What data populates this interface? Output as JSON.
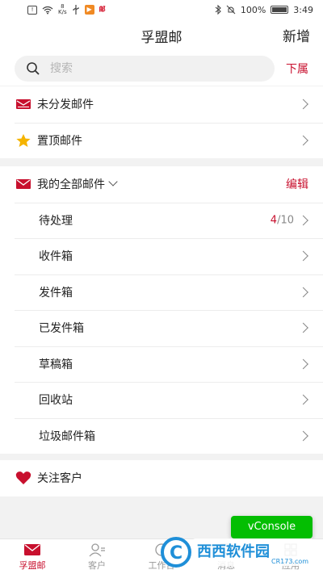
{
  "status_bar": {
    "speed": "8\nK/s",
    "battery": "100%",
    "time": "3:49"
  },
  "header": {
    "title": "孚盟邮",
    "new_label": "新增"
  },
  "search": {
    "placeholder": "搜索",
    "subordinate_label": "下属"
  },
  "quick_items": [
    {
      "label": "未分发邮件",
      "icon": "mail-stack-icon"
    },
    {
      "label": "置顶邮件",
      "icon": "star-icon"
    }
  ],
  "mailbox": {
    "title": "我的全部邮件",
    "edit_label": "编辑",
    "folders": [
      {
        "label": "待处理",
        "count_current": "4",
        "count_total": "/10"
      },
      {
        "label": "收件箱"
      },
      {
        "label": "发件箱"
      },
      {
        "label": "已发件箱"
      },
      {
        "label": "草稿箱"
      },
      {
        "label": "回收站"
      },
      {
        "label": "垃圾邮件箱"
      }
    ]
  },
  "follow": {
    "label": "关注客户"
  },
  "vconsole_label": "vConsole",
  "tabs": [
    {
      "label": "孚盟邮",
      "active": true
    },
    {
      "label": "客户"
    },
    {
      "label": "工作台"
    },
    {
      "label": "消息"
    },
    {
      "label": "应用"
    }
  ],
  "watermark": {
    "text": "西西软件园",
    "url": "CR173.com"
  },
  "colors": {
    "accent": "#c8102e",
    "vconsole": "#04be02",
    "star": "#f5b400"
  }
}
